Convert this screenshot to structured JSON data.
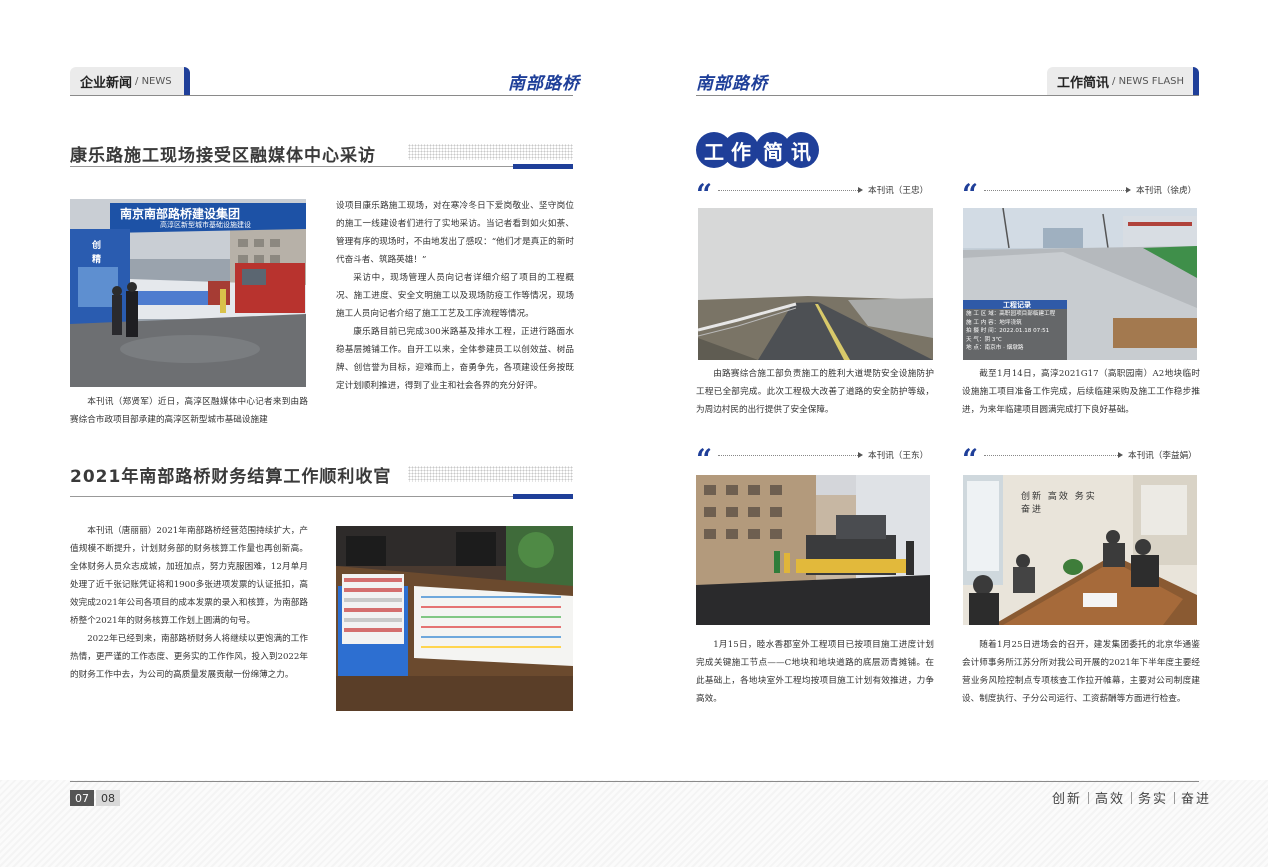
{
  "left_header": {
    "title_cn": "企业新闻",
    "title_en": "NEWS",
    "brand": "南部路桥"
  },
  "right_header": {
    "title_cn": "工作简讯",
    "title_en": "NEWS FLASH",
    "brand": "南部路桥"
  },
  "article1": {
    "headline": "康乐路施工现场接受区融媒体中心采访",
    "photo_sign_1": "南京南部路桥建设集团",
    "photo_sign_2": "高淳区新型城市基础设施建设",
    "photo_side": "创 精",
    "caption": "本刊讯（郑贤军）近日，高淳区融媒体中心记者来到由路赛综合市政项目部承建的高淳区新型城市基础设施建",
    "paragraphs": [
      "设项目康乐路施工现场，对在寒冷冬日下爱岗敬业、坚守岗位的施工一线建设者们进行了实地采访。当记者看到如火如荼、管理有序的现场时，不由地发出了感叹：“他们才是真正的新时代奋斗者、筑路英雄！”",
      "采访中，现场管理人员向记者详细介绍了项目的工程概况、施工进度、安全文明施工以及现场防疫工作等情况，现场施工人员向记者介绍了施工工艺及工序流程等情况。",
      "康乐路目前已完成300米路基及排水工程，正进行路面水稳基层摊铺工作。自开工以来，全体参建员工以创效益、树品牌、创信誉为目标，迎难而上，奋勇争先，各项建设任务按既定计划顺利推进，得到了业主和社会各界的充分好评。"
    ]
  },
  "article2": {
    "headline": "2021年南部路桥财务结算工作顺利收官",
    "paragraphs": [
      "本刊讯（唐丽丽）2021年南部路桥经营范围持续扩大，产值规模不断提升，计划财务部的财务核算工作量也再创新高。全体财务人员众志成城，加班加点，努力克服困难，12月单月处理了近千张记账凭证将和1900多张进项发票的认证抵扣，高效完成2021年公司各项目的成本发票的录入和核算，为南部路桥整个2021年的财务核算工作划上圆满的句号。",
      "2022年已经到来，南部路桥财务人将继续以更饱满的工作热情，更严谨的工作态度、更务实的工作作风，投入到2022年的财务工作中去，为公司的高质量发展贡献一份绵薄之力。"
    ]
  },
  "flash": {
    "badge_chars": [
      "工",
      "作",
      "简",
      "讯"
    ],
    "quote_mark": "“",
    "items": [
      {
        "byline": "本刊讯（王忠）",
        "text": "由路赛综合施工部负责施工的胜利大道堤防安全设施防护工程已全部完成。此次工程极大改善了道路的安全防护等级，为周边村民的出行提供了安全保障。"
      },
      {
        "byline": "本刊讯（徐虎）",
        "text": "截至1月14日，高淳2021G17（高职园南）A2地块临时设施施工项目准备工作完成，后续临建采购及施工工作稳步推进，为来年临建项目圆满完成打下良好基础。",
        "record_title": "工程记录",
        "record_lines": [
          "施 工 区 域：高职园项目部临建工程",
          "施 工 内 容：地坪浇筑",
          "拍 摄 时 间：2022.01.18 07:51",
          "天      气：阴 3℃",
          "地      点：南京市 · 烟墩路"
        ]
      },
      {
        "byline": "本刊讯（王东）",
        "text": "1月15日，睦水香郡室外工程项目已按项目施工进度计划完成关键施工节点——C地块和地块道路的底层沥青摊铺。在此基础上，各地块室外工程均按项目施工计划有效推进，力争高效。"
      },
      {
        "byline": "本刊讯（李益娟）",
        "text": "随着1月25日进场会的召开，建发集团委托的北京华通鉴会计师事务所江苏分所对我公司开展的2021年下半年度主要经营业务风险控制点专项核查工作拉开帷幕，主要对公司制度建设、制度执行、子分公司运行、工资薪酬等方面进行检查。",
        "wall_text": "创新 高效  务实 奋进"
      }
    ]
  },
  "footer": {
    "page_left": "07",
    "page_right": "08",
    "slogan": [
      "创新",
      "高效",
      "务实",
      "奋进"
    ]
  },
  "colors": {
    "brand_blue": "#1f3f99",
    "rule_gray": "#8a8a8a"
  }
}
